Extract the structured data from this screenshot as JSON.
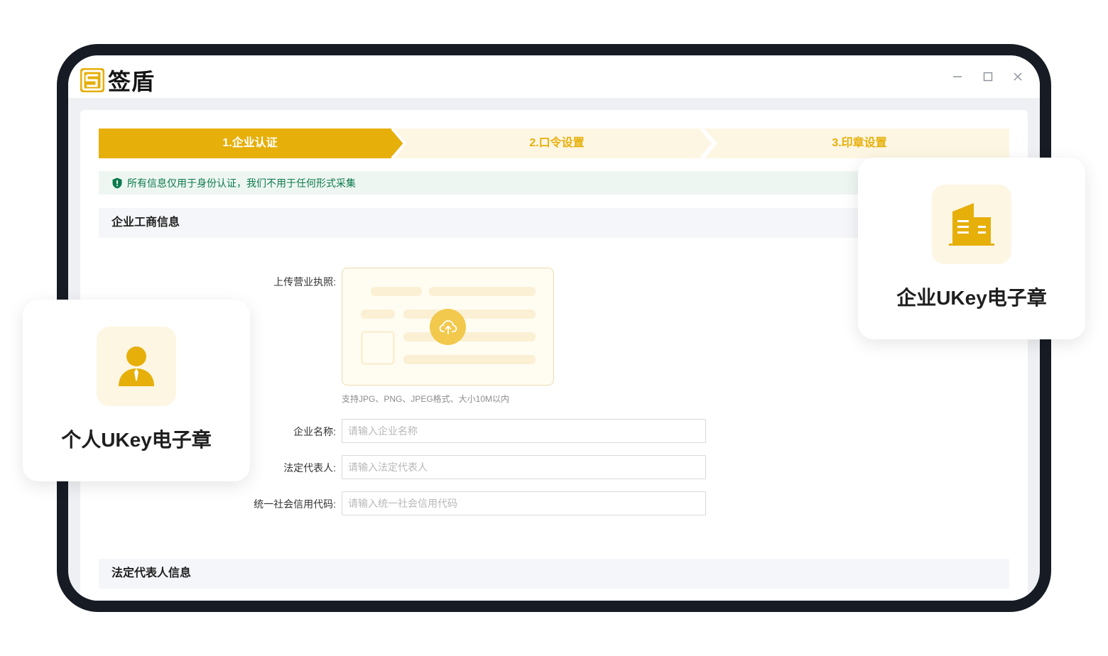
{
  "app": {
    "name": "签盾"
  },
  "window_controls": {
    "minimize_icon": "minimize-icon",
    "maximize_icon": "maximize-icon",
    "close_icon": "close-icon"
  },
  "steps": [
    {
      "label": "1.企业认证",
      "active": true
    },
    {
      "label": "2.口令设置",
      "active": false
    },
    {
      "label": "3.印章设置",
      "active": false
    }
  ],
  "notice": {
    "text": "所有信息仅用于身份认证，我们不用于任何形式采集",
    "icon": "shield-alert-icon"
  },
  "sections": {
    "business_info": "企业工商信息",
    "legal_rep_info": "法定代表人信息"
  },
  "form": {
    "upload": {
      "label": "上传营业执照:",
      "hint": "支持JPG、PNG、JPEG格式、大小10M以内",
      "icon": "cloud-upload-icon"
    },
    "company_name": {
      "label": "企业名称:",
      "placeholder": "请输入企业名称",
      "value": ""
    },
    "legal_rep": {
      "label": "法定代表人:",
      "placeholder": "请输入法定代表人",
      "value": ""
    },
    "credit_code": {
      "label": "统一社会信用代码:",
      "placeholder": "请输入统一社会信用代码",
      "value": ""
    }
  },
  "cards": {
    "personal": {
      "title": "个人UKey电子章",
      "icon": "person-icon"
    },
    "enterprise": {
      "title": "企业UKey电子章",
      "icon": "building-icon"
    }
  },
  "colors": {
    "accent": "#e6af0a",
    "accent_light": "#fdf6e3",
    "notice_bg": "#eef6f2",
    "notice_text": "#0b7a4a",
    "frame": "#161b24"
  }
}
